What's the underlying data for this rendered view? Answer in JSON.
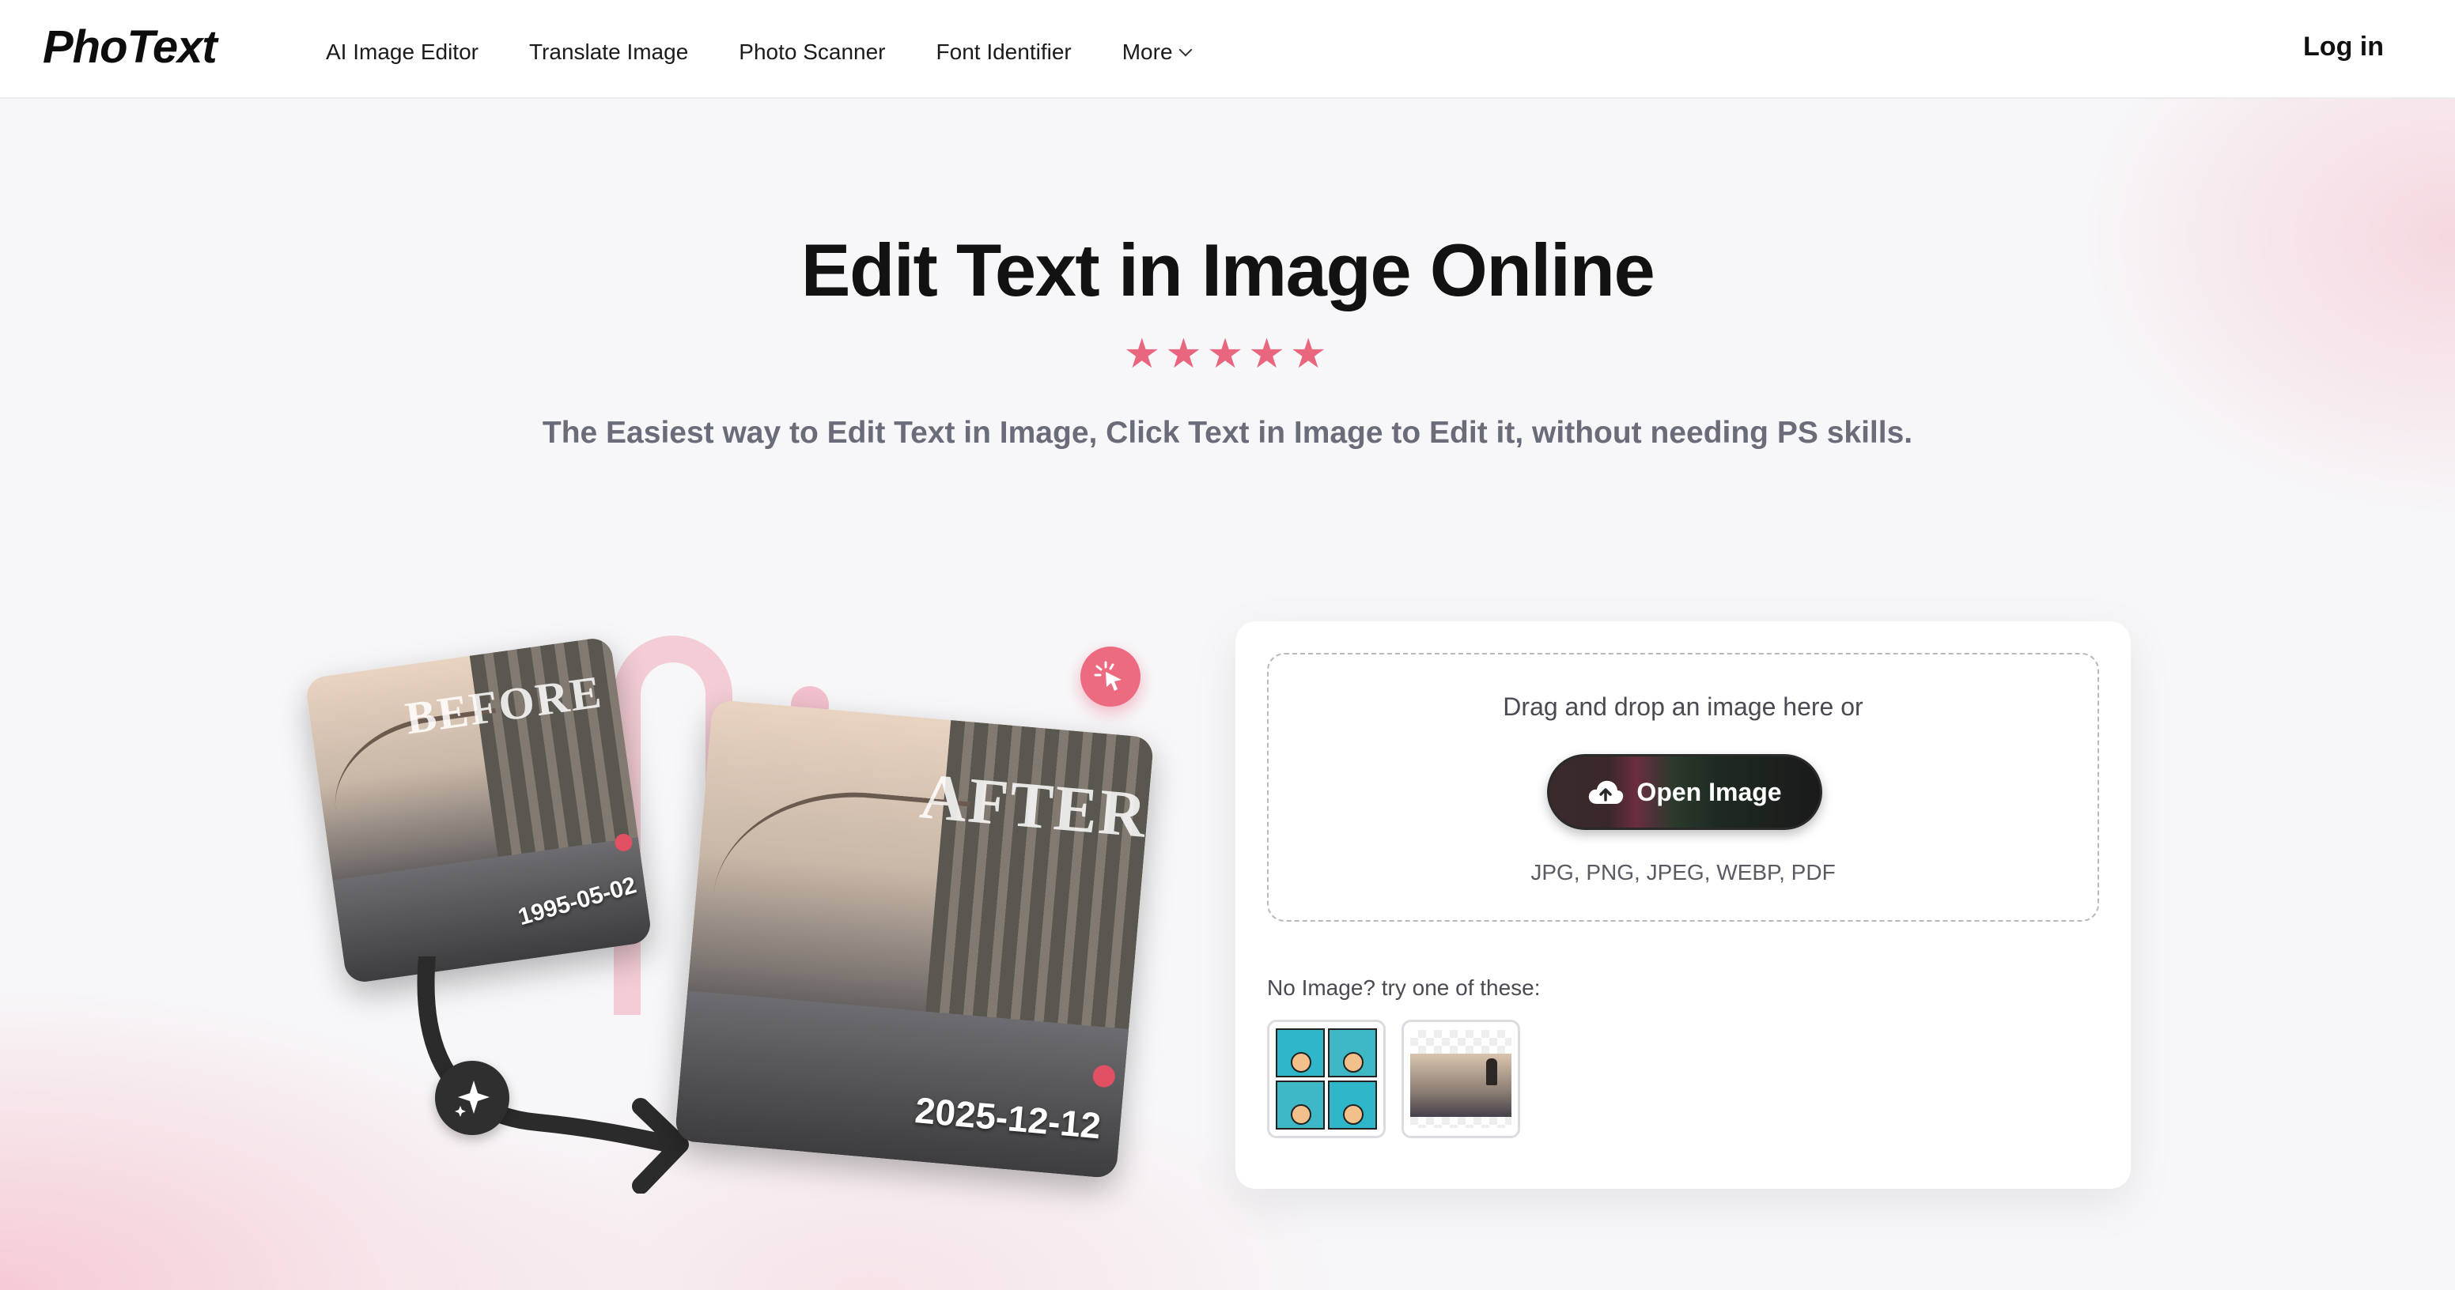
{
  "header": {
    "logo": "PhoText",
    "nav": [
      "AI Image Editor",
      "Translate Image",
      "Photo Scanner",
      "Font Identifier",
      "More"
    ],
    "login": "Log in"
  },
  "hero": {
    "title": "Edit Text in Image Online",
    "stars": "★★★★★",
    "subtitle": "The Easiest way to Edit Text in Image, Click Text in Image to Edit it, without needing PS skills."
  },
  "illustration": {
    "before_label": "BEFORE",
    "before_date": "1995-05-02",
    "after_label": "AFTER",
    "after_date": "2025-12-12"
  },
  "upload": {
    "drop_text": "Drag and drop an image here or",
    "button_label": "Open Image",
    "formats": "JPG, PNG, JPEG, WEBP, PDF",
    "try_text": "No Image? try one of these:"
  },
  "colors": {
    "accent_pink": "#ec6b81",
    "star": "#e8677f",
    "button_dark": "#1a1a1a"
  }
}
